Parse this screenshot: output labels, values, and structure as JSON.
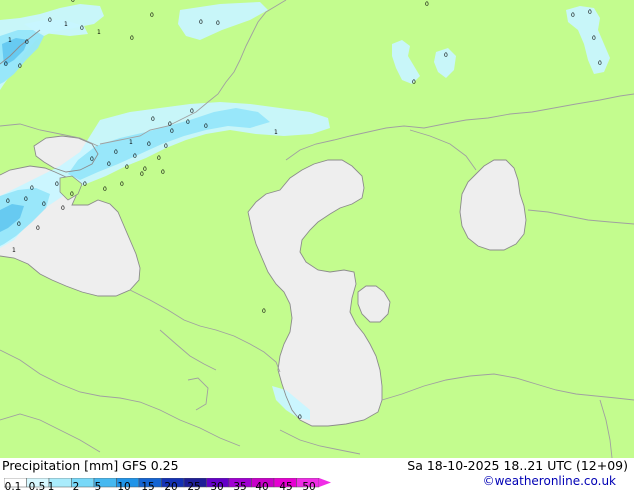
{
  "title": "Precipitation [mm]  GFS 0.25",
  "valid_time": "Sa 18-10-2025 18..21 UTC (12+09)",
  "credit": "©weatheronline.co.uk",
  "colors": {
    "land": "#c3fc8e",
    "sea": "#eeeeee",
    "border": "#a0a0a0",
    "coast": "#8c8c8c",
    "precip_light": "#c8f5ff",
    "precip_moderate": "#96e6fa",
    "precip_heavy": "#64c8f0"
  },
  "legend": {
    "labels": [
      "0.1",
      "0.5",
      "1",
      "2",
      "5",
      "10",
      "15",
      "20",
      "25",
      "30",
      "35",
      "40",
      "45",
      "50"
    ],
    "colors": [
      "#ffffff",
      "#d7f8ff",
      "#aaecfc",
      "#78d8f8",
      "#46b8f0",
      "#2094e8",
      "#1464d2",
      "#1432b4",
      "#1e1e96",
      "#6400c8",
      "#a000d2",
      "#c800c8",
      "#e600d2",
      "#f02ce6"
    ]
  },
  "precip_values": [
    "1",
    "1",
    "0",
    "0",
    "0",
    "1",
    "0",
    "0",
    "0",
    "0",
    "0",
    "0",
    "0",
    "0",
    "0",
    "0",
    "0",
    "0",
    "0",
    "0",
    "0",
    "0",
    "0",
    "0",
    "1",
    "0",
    "0",
    "1",
    "0",
    "0",
    "0",
    "0",
    "0",
    "0",
    "0",
    "0",
    "0",
    "0",
    "0",
    "0",
    "0",
    "1",
    "0",
    "0",
    "0",
    "0",
    "0",
    "0",
    "0",
    "0",
    "0",
    "0",
    "0",
    "0"
  ]
}
